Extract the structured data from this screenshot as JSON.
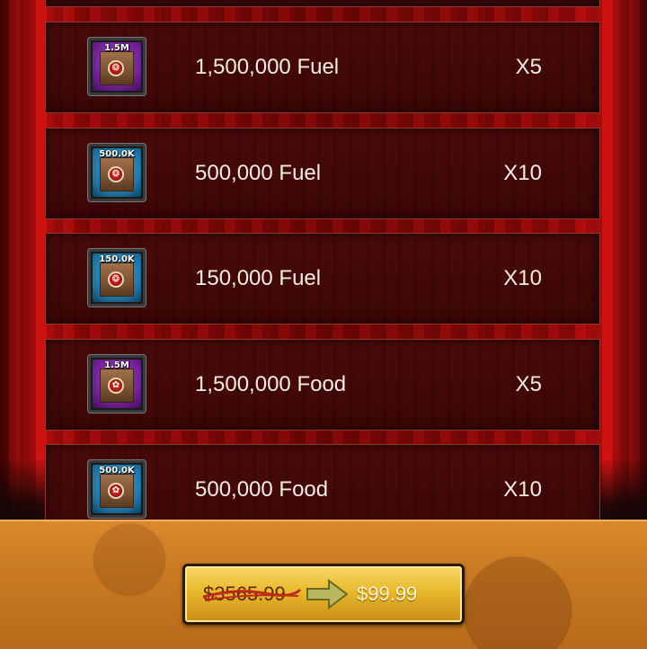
{
  "items": [
    {
      "icon_label": "1.5M",
      "icon_name": "fuel-crate-icon",
      "tile": "purple",
      "glyph": "❂",
      "name": "1,500,000 Fuel",
      "qty": "X5"
    },
    {
      "icon_label": "500.0K",
      "icon_name": "fuel-crate-icon",
      "tile": "blue",
      "glyph": "❂",
      "name": "500,000 Fuel",
      "qty": "X10"
    },
    {
      "icon_label": "150.0K",
      "icon_name": "fuel-crate-icon",
      "tile": "blue",
      "glyph": "❂",
      "name": "150,000 Fuel",
      "qty": "X10"
    },
    {
      "icon_label": "1.5M",
      "icon_name": "food-crate-icon",
      "tile": "purple",
      "glyph": "✿",
      "name": "1,500,000 Food",
      "qty": "X5"
    },
    {
      "icon_label": "500.0K",
      "icon_name": "food-crate-icon",
      "tile": "blue",
      "glyph": "✿",
      "name": "500,000 Food",
      "qty": "X10"
    }
  ],
  "purchase": {
    "old_price": "$3565.99",
    "new_price": "$99.99"
  },
  "colors": {
    "curtain_red": "#d11010",
    "row_bg": "#3c0707",
    "footer_orange": "#c97a22",
    "button_gold": "#e9b92d"
  }
}
